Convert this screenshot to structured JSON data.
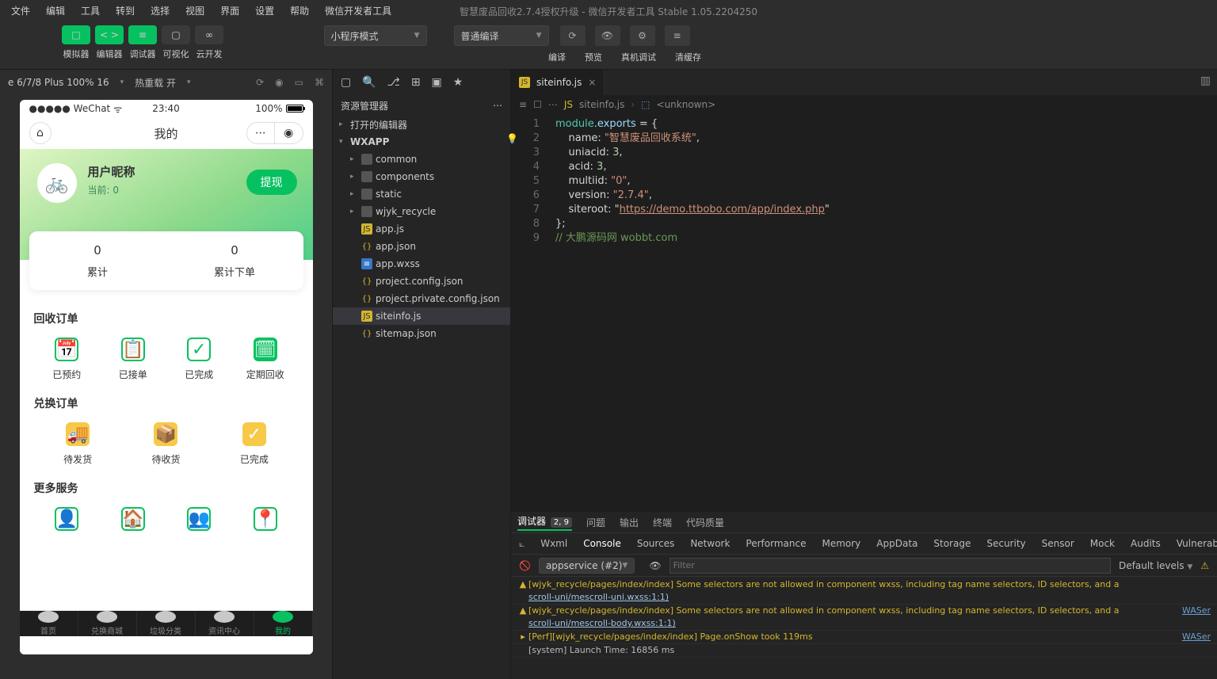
{
  "menubar": {
    "items": [
      "文件",
      "编辑",
      "工具",
      "转到",
      "选择",
      "视图",
      "界面",
      "设置",
      "帮助",
      "微信开发者工具"
    ],
    "window_title": "智慧废品回收2.7.4授权升级 - 微信开发者工具 Stable 1.05.2204250"
  },
  "toolbar": {
    "green_buttons": [
      "□",
      "< >",
      "≡"
    ],
    "gray_buttons": [
      "▢",
      "∞"
    ],
    "labels": [
      "模拟器",
      "编辑器",
      "调试器",
      "可视化",
      "云开发"
    ],
    "mode_dropdown": "小程序模式",
    "compile_dropdown": "普通编译",
    "right_labels": [
      "编译",
      "预览",
      "真机调试",
      "清缓存"
    ]
  },
  "sim_top": {
    "device": "e 6/7/8 Plus 100% 16",
    "hot_reload": "热重载 开",
    "right_icons": [
      "⟳",
      "◉",
      "▭",
      "⌘"
    ]
  },
  "phone": {
    "statusbar": {
      "left": "●●●●● WeChat",
      "wifi": "ᯤ",
      "time": "23:40",
      "right_pct": "100%"
    },
    "navbar": {
      "home_icon": "⌂",
      "title": "我的",
      "capsule_left": "⋯",
      "capsule_right": "◉"
    },
    "hero": {
      "avatar": "🚲",
      "user_title": "用户昵称",
      "user_sub": "当前: 0",
      "withdraw": "提现",
      "trash": "♻"
    },
    "stats": [
      {
        "val": "0",
        "lbl": "累计"
      },
      {
        "val": "0",
        "lbl": "累计下单"
      }
    ],
    "sections": [
      {
        "title": "回收订单",
        "items": [
          {
            "icon": "📅",
            "label": "已预约",
            "style": "green"
          },
          {
            "icon": "📋",
            "label": "已接单",
            "style": "green"
          },
          {
            "icon": "✓",
            "label": "已完成",
            "style": "green"
          },
          {
            "icon": "🗓",
            "label": "定期回收",
            "style": "green-fill"
          }
        ]
      },
      {
        "title": "兑换订单",
        "items": [
          {
            "icon": "🚚",
            "label": "待发货",
            "style": "yellow"
          },
          {
            "icon": "📦",
            "label": "待收货",
            "style": "yellow"
          },
          {
            "icon": "✓",
            "label": "已完成",
            "style": "yellow"
          }
        ]
      },
      {
        "title": "更多服务",
        "items": [
          {
            "icon": "👤",
            "label": " ",
            "style": "green"
          },
          {
            "icon": "🏠",
            "label": " ",
            "style": "green"
          },
          {
            "icon": "👥",
            "label": " ",
            "style": "green"
          },
          {
            "icon": "📍",
            "label": " ",
            "style": "green"
          }
        ]
      }
    ],
    "tabbar": [
      {
        "label": "首页",
        "active": false
      },
      {
        "label": "兑换商城",
        "active": false
      },
      {
        "label": "垃圾分类",
        "active": false
      },
      {
        "label": "资讯中心",
        "active": false
      },
      {
        "label": "我的",
        "active": true
      }
    ]
  },
  "mid_icons": [
    "▢",
    "🔍",
    "⎇",
    "⊞",
    "▣",
    "★"
  ],
  "explorer": {
    "title": "资源管理器",
    "more": "⋯",
    "open_editors": "打开的编辑器",
    "root": "WXAPP",
    "tree": [
      {
        "name": "common",
        "type": "folder"
      },
      {
        "name": "components",
        "type": "folder"
      },
      {
        "name": "static",
        "type": "folder"
      },
      {
        "name": "wjyk_recycle",
        "type": "folder"
      },
      {
        "name": "app.js",
        "type": "js"
      },
      {
        "name": "app.json",
        "type": "json"
      },
      {
        "name": "app.wxss",
        "type": "wxss"
      },
      {
        "name": "project.config.json",
        "type": "json"
      },
      {
        "name": "project.private.config.json",
        "type": "json"
      },
      {
        "name": "siteinfo.js",
        "type": "js",
        "active": true
      },
      {
        "name": "sitemap.json",
        "type": "json"
      }
    ]
  },
  "editor": {
    "tab": {
      "file": "siteinfo.js",
      "close": "×"
    },
    "tabstrip_right_icon": "▥",
    "breadcrumb_icons": [
      "≡",
      "☐",
      "⋯"
    ],
    "breadcrumb": [
      "siteinfo.js",
      "<unknown>"
    ],
    "code": {
      "module_exports": "module",
      "dot_exports": "exports",
      "op_eq": " = ",
      "brace_open": "{",
      "name_key": "name",
      "name_val": "智慧废品回收系统",
      "uniacid_key": "uniacid",
      "uniacid_val": "3",
      "acid_key": "acid",
      "acid_val": "3",
      "multiid_key": "multiid",
      "multiid_val": "0",
      "version_key": "version",
      "version_val": "2.7.4",
      "siteroot_key": "siteroot",
      "siteroot_val": "https://demo.ttbobo.com/app/index.php",
      "brace_close": "};",
      "comment": "// 大鹏源码网 wobbt.com"
    }
  },
  "devtools": {
    "tabs1": {
      "main": "调试器",
      "badge": "2, 9",
      "rest": [
        "问题",
        "输出",
        "终端",
        "代码质量"
      ]
    },
    "tabs2": [
      "Wxml",
      "Console",
      "Sources",
      "Network",
      "Performance",
      "Memory",
      "AppData",
      "Storage",
      "Security",
      "Sensor",
      "Mock",
      "Audits",
      "Vulnerab"
    ],
    "tabs2_selected": "Console",
    "context_dropdown": "appservice (#2)",
    "filter_placeholder": "Filter",
    "level": "Default levels",
    "issue_icon": "⚠",
    "lines": [
      {
        "type": "warn",
        "text": "[wjyk_recycle/pages/index/index] Some selectors are not allowed in component wxss, including tag name selectors, ID selectors, and a",
        "link": "scroll-uni/mescroll-uni.wxss:1:1)"
      },
      {
        "type": "warn",
        "text": "[wjyk_recycle/pages/index/index] Some selectors are not allowed in component wxss, including tag name selectors, ID selectors, and a",
        "link": "scroll-uni/mescroll-body.wxss:1:1)",
        "src": "WASer"
      },
      {
        "type": "warn",
        "arrow": "▸",
        "text": "[Perf][wjyk_recycle/pages/index/index] Page.onShow took 119ms",
        "src": "WASer"
      },
      {
        "type": "info",
        "text": "[system] Launch Time: 16856 ms"
      }
    ]
  }
}
